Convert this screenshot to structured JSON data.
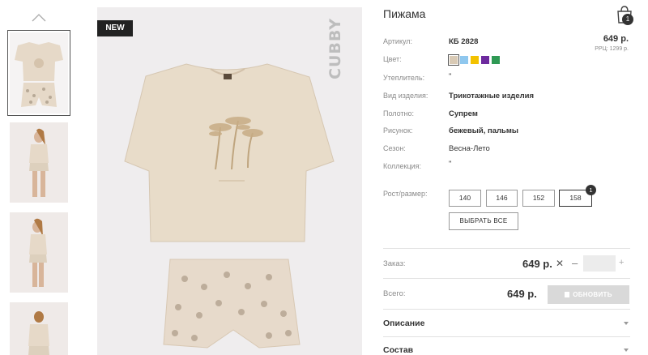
{
  "product": {
    "title": "Пижама",
    "badge": "NEW",
    "brand": "CUBBY",
    "price": "649 р.",
    "rrc": "РРЦ: 1299 р."
  },
  "cart": {
    "count": "1"
  },
  "attributes": [
    {
      "label": "Артикул:",
      "value": "КБ 2828"
    },
    {
      "label": "Цвет:",
      "value": ""
    },
    {
      "label": "Утеплитель:",
      "value": "\""
    },
    {
      "label": "Вид изделия:",
      "value": "Трикотажные изделия"
    },
    {
      "label": "Полотно:",
      "value": "Супрем"
    },
    {
      "label": "Рисунок:",
      "value": "бежевый, пальмы"
    },
    {
      "label": "Сезон:",
      "value": "Весна-Лето"
    },
    {
      "label": "Коллекция:",
      "value": "\""
    }
  ],
  "colors": [
    "#d9cab5",
    "#8fc7ee",
    "#f3c200",
    "#6d2a9e",
    "#2f9954"
  ],
  "sizes": {
    "label": "Рост/размер:",
    "options": [
      "140",
      "146",
      "152",
      "158"
    ],
    "selected": "158",
    "selected_count": "1",
    "select_all": "ВЫБРАТЬ ВСЕ"
  },
  "order": {
    "label": "Заказ:",
    "price": "649 р.",
    "times": "✕",
    "minus": "–",
    "plus": "+",
    "quantity": ""
  },
  "total": {
    "label": "Всего:",
    "price": "649 р.",
    "update": "ОБНОВИТЬ"
  },
  "accordion": [
    "Описание",
    "Состав"
  ]
}
